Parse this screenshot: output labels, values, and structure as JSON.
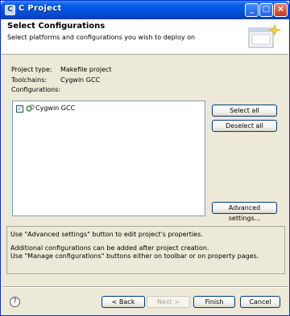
{
  "window": {
    "title": "C Project",
    "minimize": "_",
    "maximize": "□",
    "close": "×"
  },
  "header": {
    "title": "Select Configurations",
    "subtitle": "Select platforms and configurations you wish to deploy on"
  },
  "project": {
    "type_label": "Project type:",
    "type_value": "Makefile project",
    "toolchains_label": "Toolchains:",
    "toolchains_value": "Cygwin GCC",
    "configurations_label": "Configurations:"
  },
  "configurations": [
    {
      "label": "Cygwin GCC",
      "checked": true
    }
  ],
  "buttons": {
    "select_all": "Select all",
    "deselect_all": "Deselect all",
    "advanced": "Advanced settings...",
    "back": "< Back",
    "next": "Next >",
    "finish": "Finish",
    "cancel": "Cancel"
  },
  "messages": {
    "line1": "Use \"Advanced settings\" button to edit project's properties.",
    "line2": "Additional configurations can be added after project creation.",
    "line3": "Use \"Manage configurations\" buttons either on toolbar or on property pages."
  },
  "icons": {
    "help": "?",
    "checkmark": "✓"
  }
}
